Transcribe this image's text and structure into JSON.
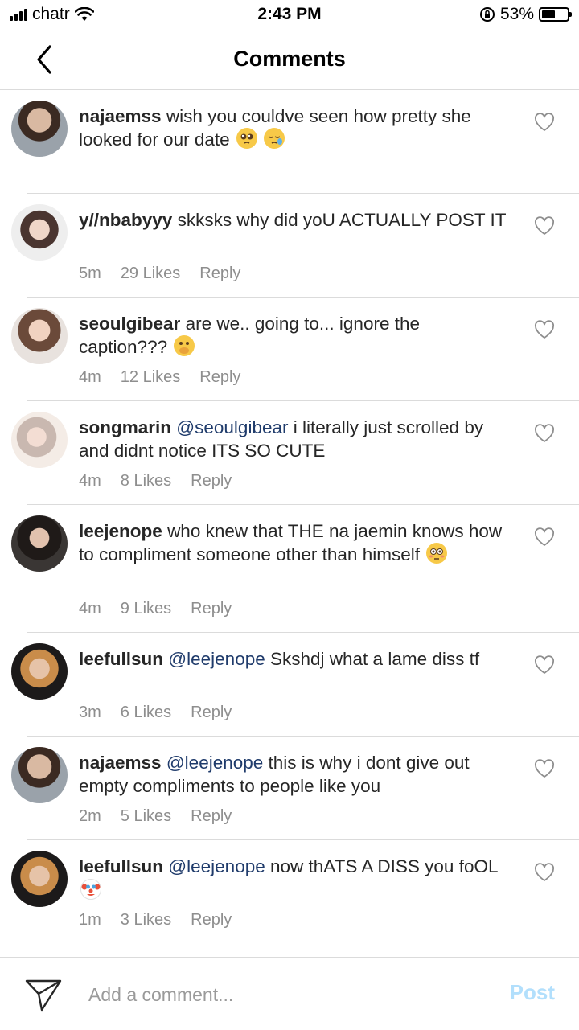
{
  "status_bar": {
    "carrier": "chatr",
    "time": "2:43 PM",
    "battery_percent": "53%",
    "battery_level": 0.53,
    "icons": [
      "signal-icon",
      "wifi-icon",
      "orientation-lock-icon",
      "battery-icon"
    ]
  },
  "header": {
    "title": "Comments",
    "back_icon": "chevron-left-icon"
  },
  "caption": {
    "username": "najaemss",
    "text": "wish you couldve seen how pretty she looked for our date",
    "emojis": [
      "pleading-face-emoji",
      "sleepy-face-emoji"
    ]
  },
  "comments": [
    {
      "username": "y//nbabyyy",
      "mention": "",
      "text": "skksks why did yoU ACTUALLY POST IT",
      "time": "5m",
      "likes": "29 Likes",
      "reply": "Reply",
      "emojis": []
    },
    {
      "username": "seoulgibear",
      "mention": "",
      "text": "are we.. going to... ignore the caption???",
      "time": "4m",
      "likes": "12 Likes",
      "reply": "Reply",
      "emojis": [
        "hand-over-mouth-emoji"
      ]
    },
    {
      "username": "songmarin",
      "mention": "@seoulgibear",
      "text": "i literally just scrolled by and didnt notice ITS SO CUTE",
      "time": "4m",
      "likes": "8 Likes",
      "reply": "Reply",
      "emojis": []
    },
    {
      "username": "leejenope",
      "mention": "",
      "text": "who knew that THE na jaemin knows how to compliment someone other than himself",
      "time": "4m",
      "likes": "9 Likes",
      "reply": "Reply",
      "emojis": [
        "flushed-face-emoji"
      ]
    },
    {
      "username": "leefullsun",
      "mention": "@leejenope",
      "text": "Skshdj what a lame diss tf",
      "time": "3m",
      "likes": "6 Likes",
      "reply": "Reply",
      "emojis": []
    },
    {
      "username": "najaemss",
      "mention": "@leejenope",
      "text": "this is why i dont give out empty compliments to people like you",
      "time": "2m",
      "likes": "5 Likes",
      "reply": "Reply",
      "emojis": []
    },
    {
      "username": "leefullsun",
      "mention": "@leejenope",
      "text": "now thATS A DISS you foOL",
      "time": "1m",
      "likes": "3 Likes",
      "reply": "Reply",
      "emojis": [
        "clown-face-emoji"
      ]
    }
  ],
  "footer": {
    "placeholder": "Add a comment...",
    "post_label": "Post"
  },
  "colors": {
    "text": "#262626",
    "meta": "#8e8e8e",
    "mention": "#1f3b6b",
    "post_disabled": "#b2dffc",
    "divider": "#dbdbdb"
  }
}
